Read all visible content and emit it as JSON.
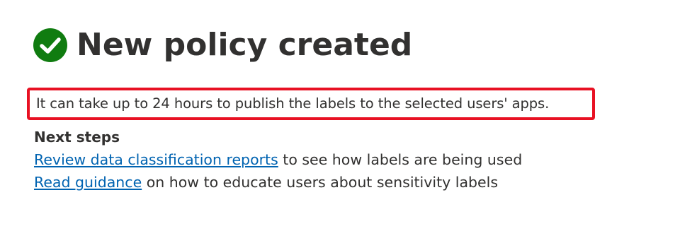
{
  "header": {
    "icon": "checkmark-circle-icon",
    "icon_color": "#107c10",
    "title": "New policy created"
  },
  "notice": {
    "text": "It can take up to 24 hours to publish the labels to the selected users' apps.",
    "highlight_color": "#e81123"
  },
  "next_steps": {
    "heading": "Next steps",
    "items": [
      {
        "link_text": "Review data classification reports",
        "suffix": " to see how labels are being used"
      },
      {
        "link_text": "Read guidance",
        "suffix": " on how to educate users about sensitivity labels"
      }
    ],
    "link_color": "#0063b1"
  }
}
